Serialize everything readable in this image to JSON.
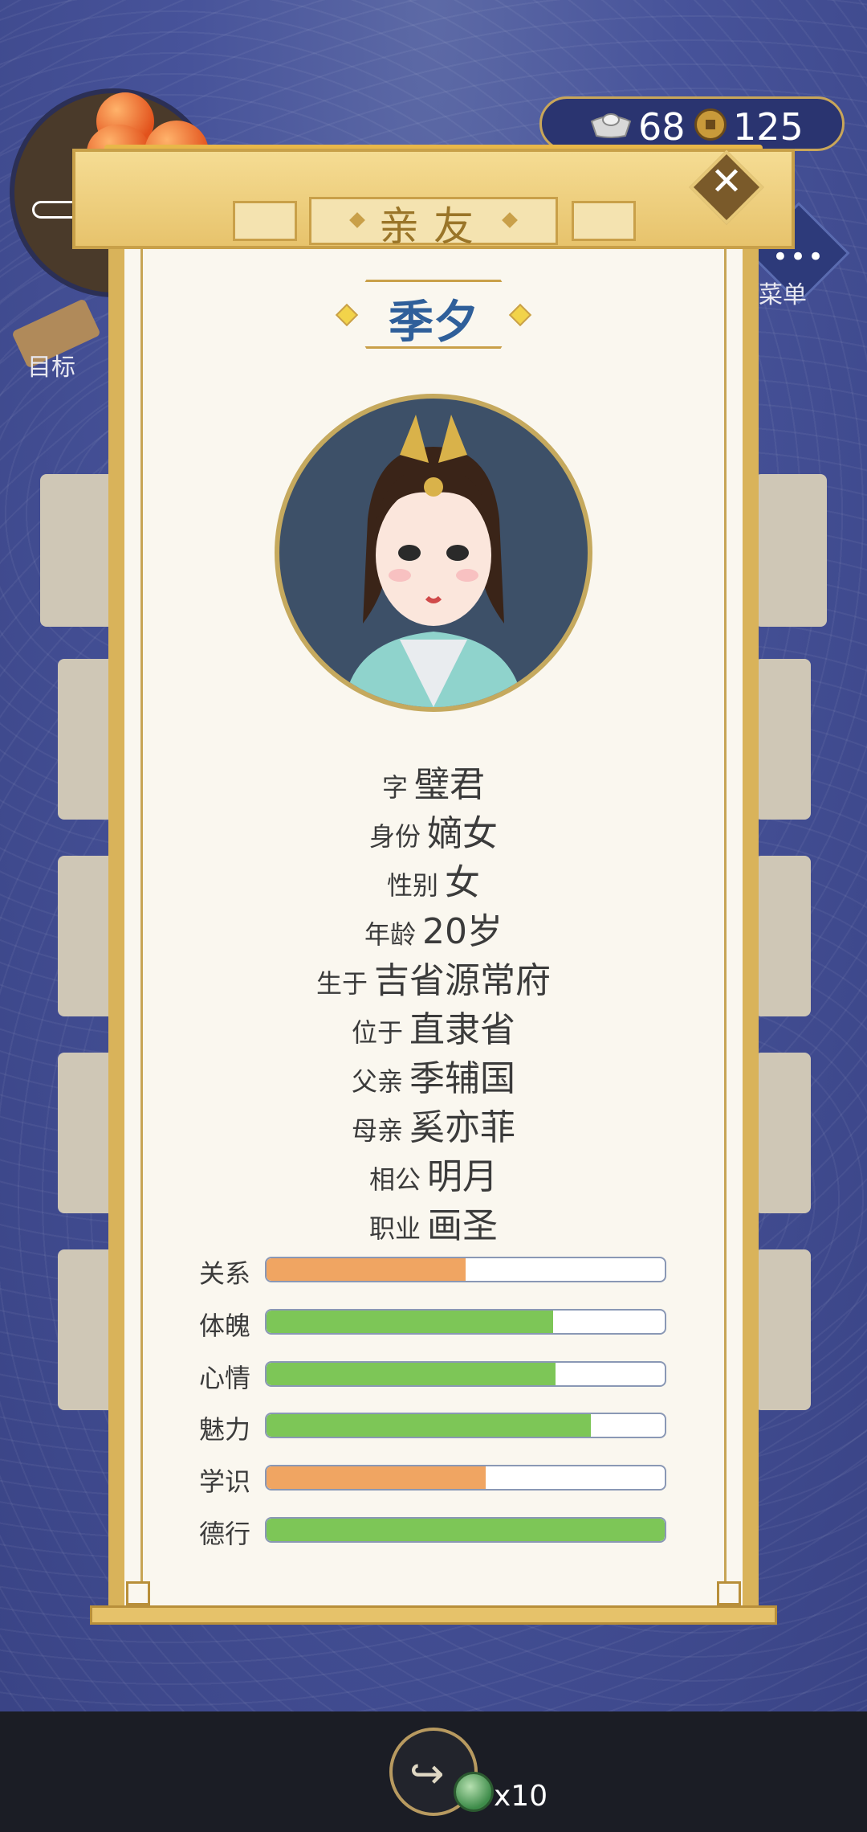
{
  "hud": {
    "silver_ingots": "68",
    "coins": "125",
    "menu_label": "菜单",
    "goal_label": "目标"
  },
  "dialog": {
    "title": "亲友",
    "close_icon": "close-icon"
  },
  "person": {
    "name": "季夕",
    "info": [
      {
        "key": "字",
        "value": "璧君"
      },
      {
        "key": "身份",
        "value": "嫡女"
      },
      {
        "key": "性别",
        "value": "女"
      },
      {
        "key": "年龄",
        "value": "20岁"
      },
      {
        "key": "生于",
        "value": "吉省源常府"
      },
      {
        "key": "位于",
        "value": "直隶省"
      },
      {
        "key": "父亲",
        "value": "季辅国"
      },
      {
        "key": "母亲",
        "value": "奚亦菲"
      },
      {
        "key": "相公",
        "value": "明月"
      },
      {
        "key": "职业",
        "value": "画圣"
      }
    ],
    "stats": [
      {
        "label": "关系",
        "fraction": 0.5,
        "color": "#f0a562"
      },
      {
        "label": "体魄",
        "fraction": 0.72,
        "color": "#7dc657"
      },
      {
        "label": "心情",
        "fraction": 0.725,
        "color": "#7dc657"
      },
      {
        "label": "魅力",
        "fraction": 0.815,
        "color": "#7dc657"
      },
      {
        "label": "学识",
        "fraction": 0.55,
        "color": "#f0a562"
      },
      {
        "label": "德行",
        "fraction": 1.0,
        "color": "#7dc657"
      }
    ]
  },
  "bottom": {
    "share_icon": "share-icon",
    "token_count": "x10"
  }
}
